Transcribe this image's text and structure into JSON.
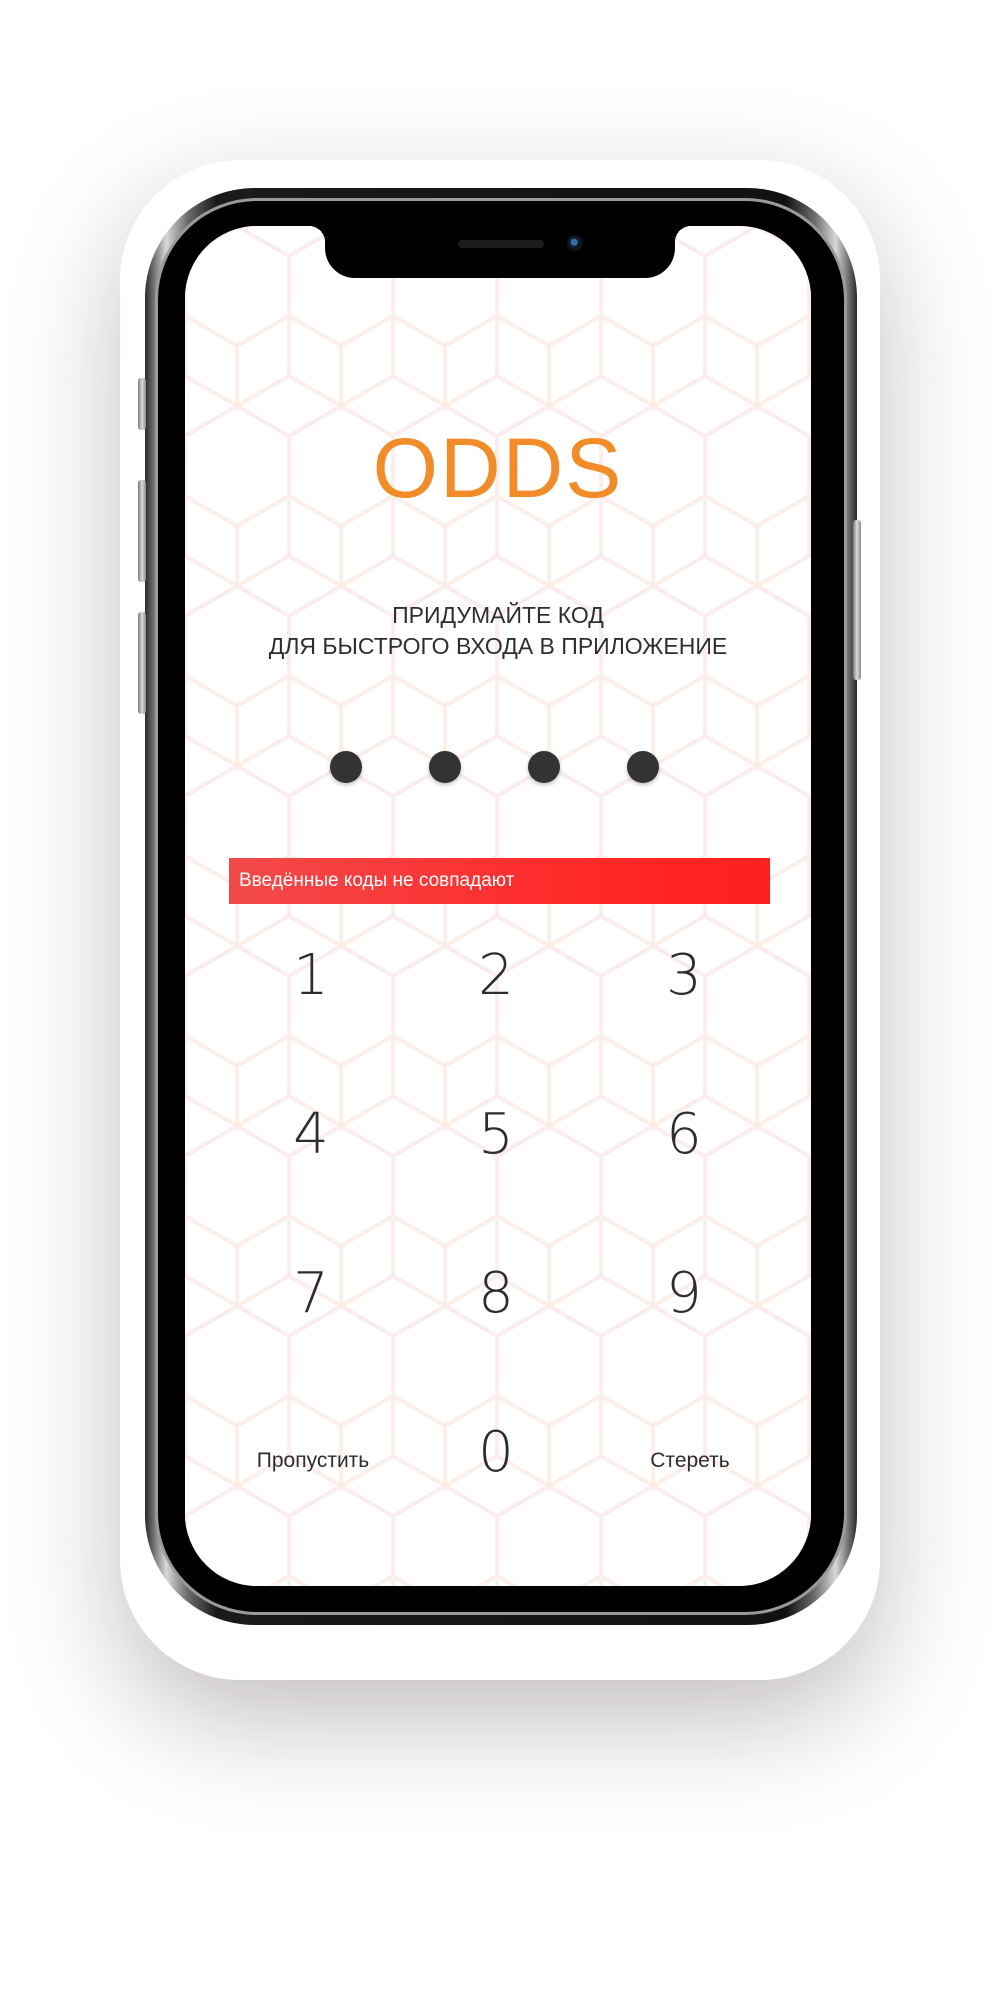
{
  "app": {
    "logo": "ODDS",
    "prompt_line1": "ПРИДУМАЙТЕ КОД",
    "prompt_line2": "ДЛЯ БЫСТРОГО ВХОДА В ПРИЛОЖЕНИЕ",
    "pin_length": 4,
    "pin_filled": 4,
    "error_message": "Введённые коды не совпадают"
  },
  "keypad": {
    "k1": "1",
    "k2": "2",
    "k3": "3",
    "k4": "4",
    "k5": "5",
    "k6": "6",
    "k7": "7",
    "k8": "8",
    "k9": "9",
    "k0": "0",
    "skip_label": "Пропустить",
    "erase_label": "Стереть"
  },
  "colors": {
    "brand": "#F28C28",
    "error": "#FF2323",
    "text": "#2D2D2D"
  }
}
